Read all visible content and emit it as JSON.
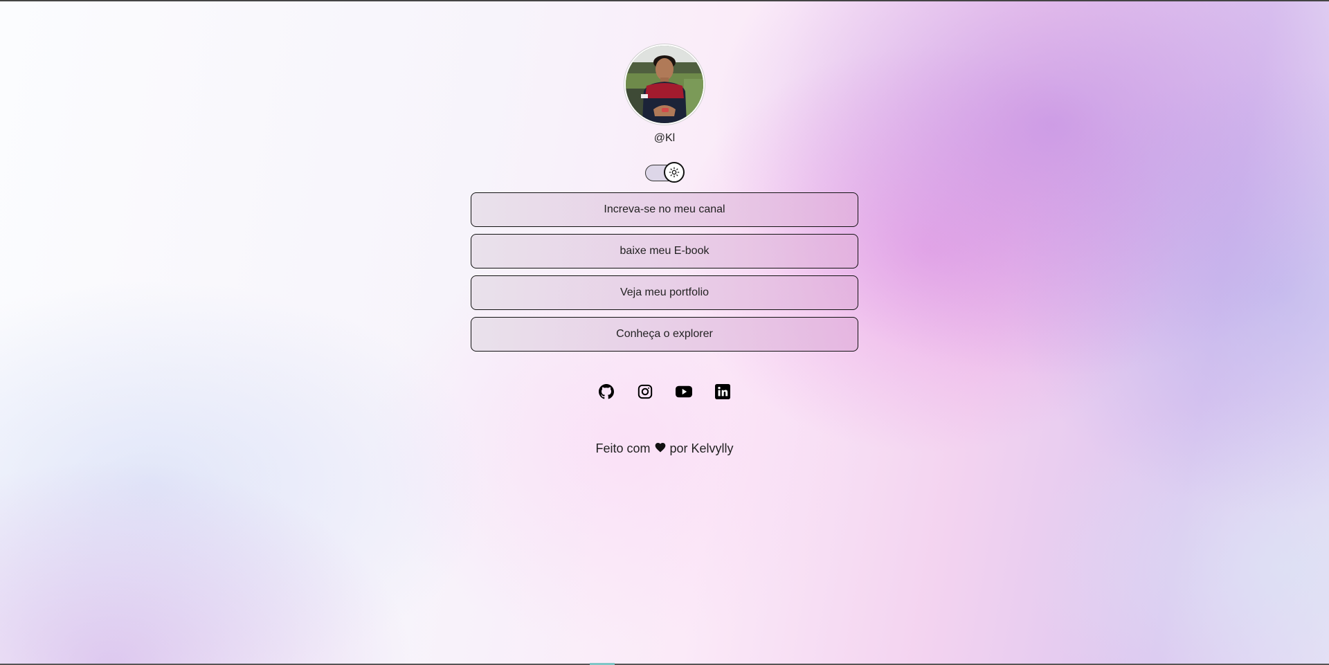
{
  "profile": {
    "handle": "@Kl",
    "avatar_alt": ""
  },
  "theme_toggle": {
    "icon": "sun-icon",
    "state": "light"
  },
  "links": [
    {
      "label": "Increva-se no meu canal"
    },
    {
      "label": "baixe meu E-book"
    },
    {
      "label": "Veja meu portfolio"
    },
    {
      "label": "Conheça o explorer"
    }
  ],
  "socials": [
    {
      "icon": "github-icon"
    },
    {
      "icon": "instagram-icon"
    },
    {
      "icon": "youtube-icon"
    },
    {
      "icon": "linkedin-icon"
    }
  ],
  "footer": {
    "prefix": "Feito com",
    "icon": "heart-icon",
    "suffix": "por Kelvylly"
  },
  "colors": {
    "button_border": "#111111",
    "button_fill_start": "#e8e0ea",
    "button_fill_end": "#e1b0dc",
    "accent_purple": "#b278de",
    "accent_pink": "#e68ce1"
  }
}
